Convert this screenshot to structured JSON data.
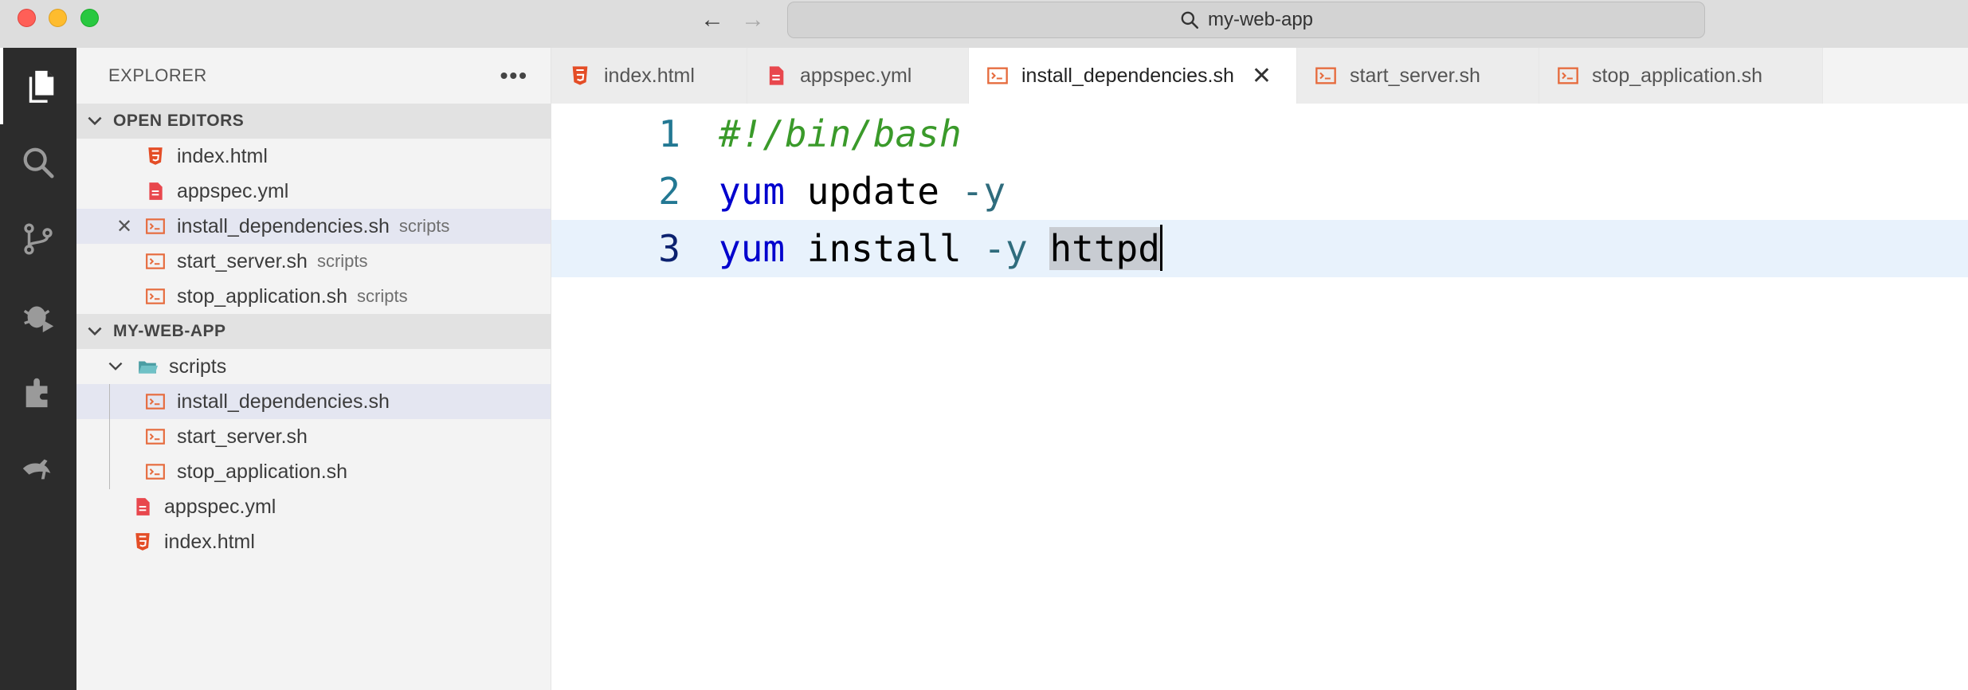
{
  "window": {
    "search_text": "my-web-app"
  },
  "sidebar": {
    "title": "EXPLORER",
    "more_label": "•••",
    "open_editors": {
      "label": "OPEN EDITORS",
      "items": [
        {
          "name": "index.html",
          "desc": "",
          "type": "html"
        },
        {
          "name": "appspec.yml",
          "desc": "",
          "type": "yml"
        },
        {
          "name": "install_dependencies.sh",
          "desc": "scripts",
          "type": "sh"
        },
        {
          "name": "start_server.sh",
          "desc": "scripts",
          "type": "sh"
        },
        {
          "name": "stop_application.sh",
          "desc": "scripts",
          "type": "sh"
        }
      ]
    },
    "project": {
      "label": "MY-WEB-APP",
      "folder": "scripts",
      "folder_items": [
        "install_dependencies.sh",
        "start_server.sh",
        "stop_application.sh"
      ],
      "root_items": [
        "appspec.yml",
        "index.html"
      ]
    }
  },
  "tabs": [
    {
      "label": "index.html",
      "type": "html"
    },
    {
      "label": "appspec.yml",
      "type": "yml"
    },
    {
      "label": "install_dependencies.sh",
      "type": "sh",
      "active": true
    },
    {
      "label": "start_server.sh",
      "type": "sh"
    },
    {
      "label": "stop_application.sh",
      "type": "sh"
    }
  ],
  "editor": {
    "lines": [
      {
        "num": "1",
        "tokens": [
          "#!/bin/bash"
        ]
      },
      {
        "num": "2",
        "tokens": [
          "yum",
          " update ",
          "-y"
        ]
      },
      {
        "num": "3",
        "tokens": [
          "yum",
          " install ",
          "-y",
          " ",
          "httpd"
        ]
      }
    ],
    "current_line": 3,
    "selected_text": "httpd"
  },
  "colors": {
    "activity_bg": "#2c2c2c",
    "sidebar_bg": "#f3f3f3",
    "html_icon": "#e44d26",
    "yml_icon": "#e8474d",
    "sh_icon": "#e66b3d",
    "folder_icon": "#4a9da3",
    "comment": "#3a9a2a",
    "keyword": "#0000cd",
    "line_number": "#237893"
  },
  "icons": {
    "activity": [
      "files-icon",
      "search-icon",
      "source-control-icon",
      "run-debug-icon",
      "extensions-icon",
      "aws-toolkit-icon"
    ]
  }
}
